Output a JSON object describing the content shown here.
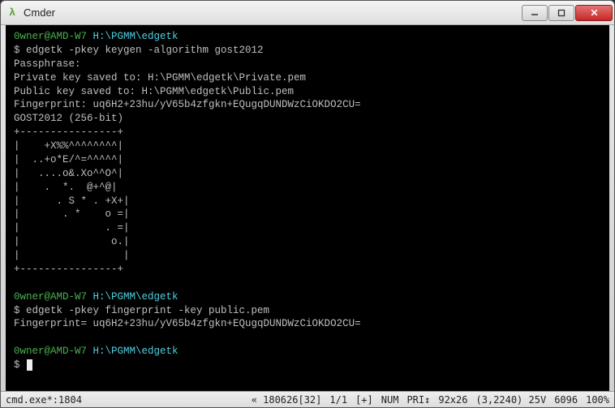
{
  "window": {
    "title": "Cmder"
  },
  "terminal": {
    "prompt1_user": "0wner@AMD-W7 ",
    "prompt1_path": "H:\\PGMM\\edgetk",
    "line_cmd1": "$ edgetk -pkey keygen -algorithm gost2012",
    "line_pass": "Passphrase:",
    "line_priv": "Private key saved to: H:\\PGMM\\edgetk\\Private.pem",
    "line_pub": "Public key saved to: H:\\PGMM\\edgetk\\Public.pem",
    "line_fp1": "Fingerprint: uq6H2+23hu/yV65b4zfgkn+EQugqDUNDWzCiOKDO2CU=",
    "line_alg": "GOST2012 (256-bit)",
    "art0": "+----------------+",
    "art1": "|    +X%%^^^^^^^^|",
    "art2": "|  ..+o*E/^=^^^^^|",
    "art3": "|   ....o&.Xo^^O^|",
    "art4": "|    .  *.  @+^@|",
    "art5": "|      . S * . +X+|",
    "art6": "|       . *    o =|",
    "art7": "|              . =|",
    "art8": "|               o.|",
    "art9": "|                 |",
    "art10": "+----------------+",
    "prompt2_user": "0wner@AMD-W7 ",
    "prompt2_path": "H:\\PGMM\\edgetk",
    "line_cmd2": "$ edgetk -pkey fingerprint -key public.pem",
    "line_fp2": "Fingerprint= uq6H2+23hu/yV65b4zfgkn+EQugqDUNDWzCiOKDO2CU=",
    "prompt3_user": "0wner@AMD-W7 ",
    "prompt3_path": "H:\\PGMM\\edgetk",
    "line_cmd3": "$ "
  },
  "status": {
    "left": "cmd.exe*:1804",
    "r1": "« 180626[32]",
    "r2": "1/1",
    "r3": "[+]",
    "r4": "NUM",
    "r5": "PRI↕",
    "r6": "92x26",
    "r7": "(3,2240) 25V",
    "r8": "6096",
    "r9": "100%"
  }
}
